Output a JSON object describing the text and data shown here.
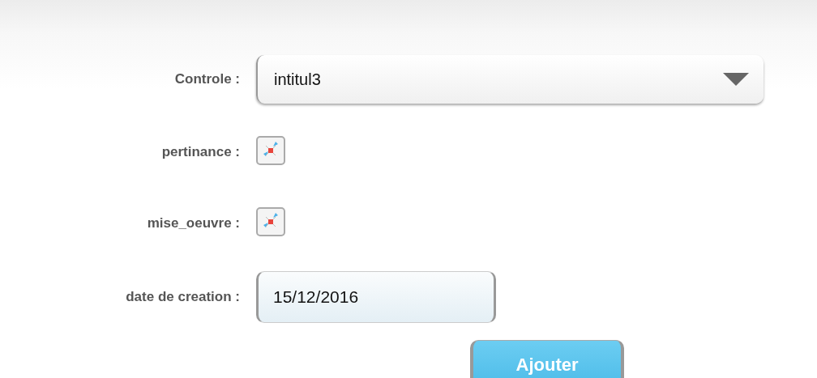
{
  "fields": [
    {
      "kind": "select",
      "label": "Controle :",
      "value": "intitul3"
    },
    {
      "kind": "image",
      "label": "pertinance :"
    },
    {
      "kind": "image",
      "label": "mise_oeuvre :"
    },
    {
      "kind": "date",
      "label": "date de creation :",
      "value": "15/12/2016"
    }
  ],
  "submit": {
    "label": "Ajouter"
  }
}
